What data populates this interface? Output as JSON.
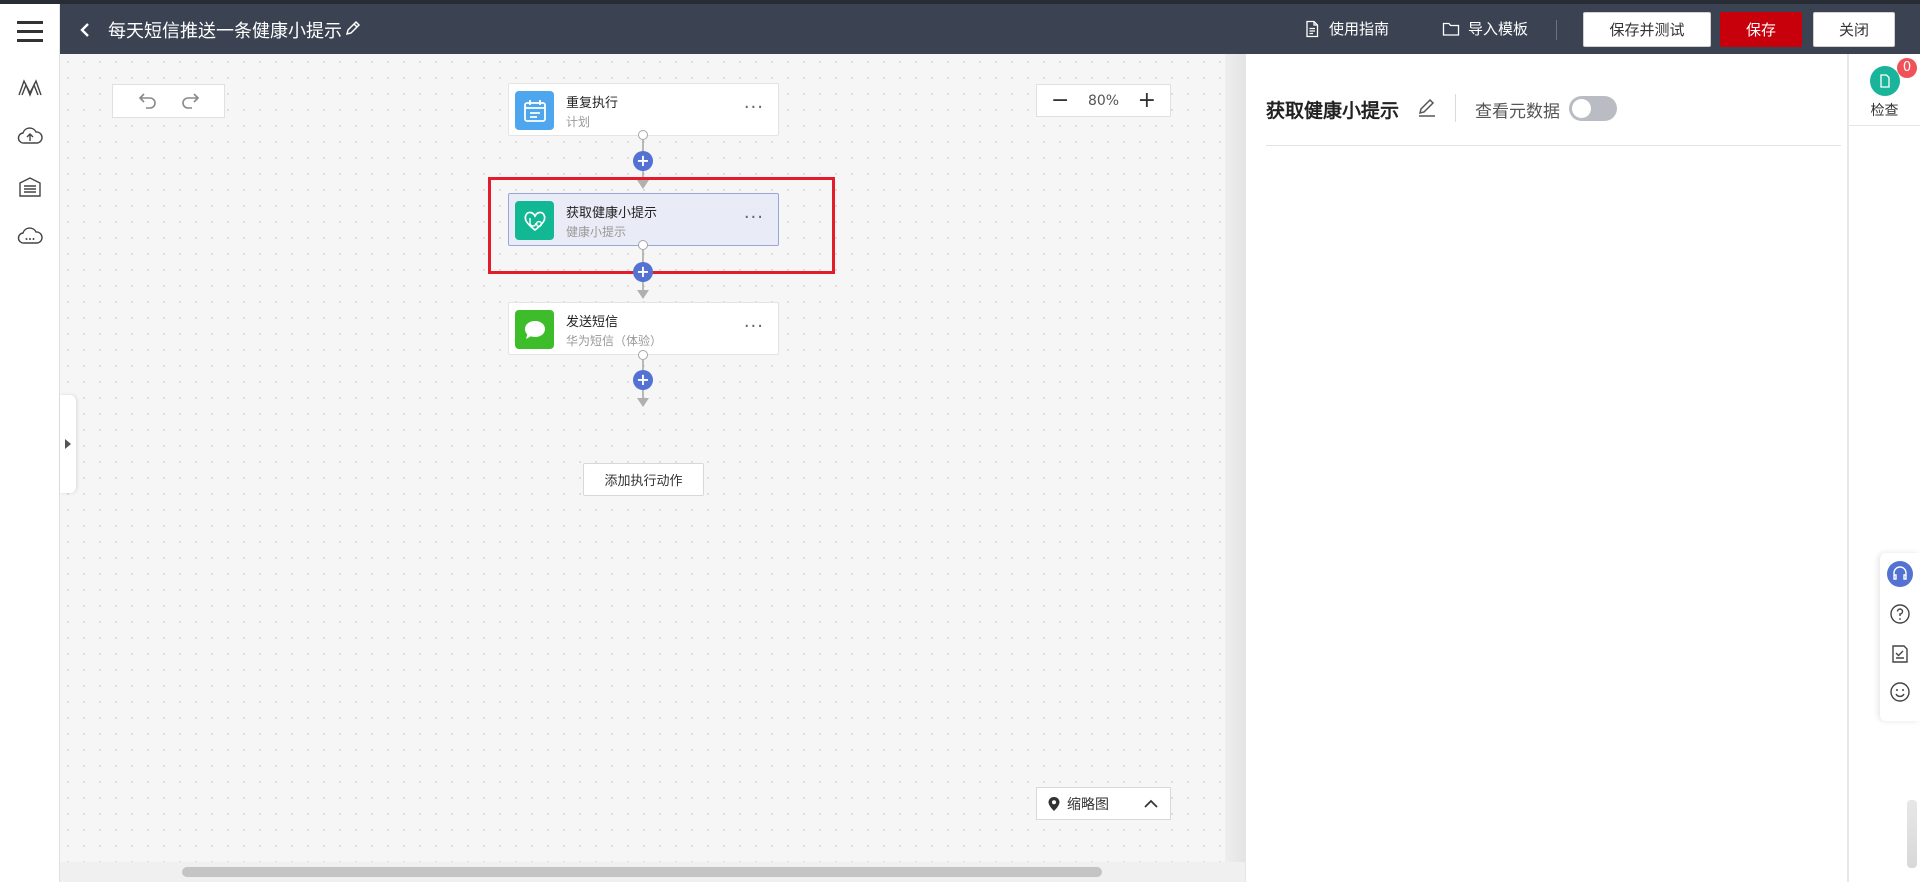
{
  "header": {
    "title": "每天短信推送一条健康小提示",
    "guide_label": "使用指南",
    "import_label": "导入模板",
    "save_test_label": "保存并测试",
    "save_label": "保存",
    "close_label": "关闭"
  },
  "leftnav": {
    "icons": [
      "logo-icon",
      "cloud-upload-icon",
      "warehouse-icon",
      "cloud-more-icon"
    ]
  },
  "canvas": {
    "zoom": "80%",
    "add_action_label": "添加执行动作",
    "minimap_label": "缩略图",
    "nodes": [
      {
        "title": "重复执行",
        "subtitle": "计划",
        "icon": "schedule-icon",
        "color": "#4ea6ee"
      },
      {
        "title": "获取健康小提示",
        "subtitle": "健康小提示",
        "icon": "heart-stethoscope-icon",
        "color": "#12b894"
      },
      {
        "title": "发送短信",
        "subtitle": "华为短信（体验）",
        "icon": "message-icon",
        "color": "#3ebd2b"
      }
    ]
  },
  "panel": {
    "title": "获取健康小提示",
    "metadata_label": "查看元数据",
    "metadata_on": false
  },
  "sidebar": {
    "check_label": "检查",
    "check_count": "0"
  },
  "colors": {
    "topbar": "#3b4252",
    "primary_red": "#c7000b",
    "plus_blue": "#5472d3",
    "highlight": "#e21c2a"
  }
}
